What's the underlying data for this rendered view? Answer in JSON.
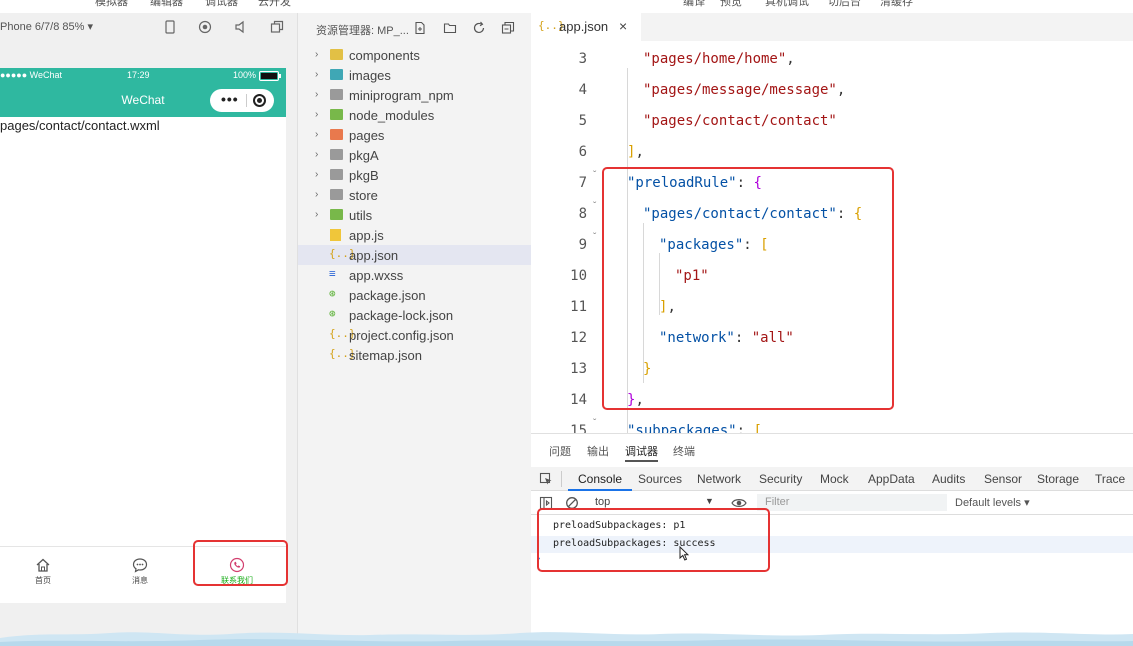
{
  "top_menu": [
    "模拟器",
    "编辑器",
    "调试器",
    "云开发",
    "编译",
    "预览",
    "真机调试",
    "切后台",
    "清缓存"
  ],
  "simulator": {
    "model": "Phone 6/7/8 85%",
    "dropdown_glyph": "▾",
    "status": {
      "carrier": "●●●●● WeChat",
      "time": "17:29",
      "battery": "100%"
    },
    "nav_title": "WeChat",
    "capsule_dots": "•••",
    "page_path": "pages/contact/contact.wxml",
    "tabs": [
      {
        "label": "首页",
        "icon": "home-icon"
      },
      {
        "label": "消息",
        "icon": "message-icon"
      },
      {
        "label": "联系我们",
        "icon": "phone-icon"
      }
    ]
  },
  "explorer": {
    "title": "资源管理器: MP_...",
    "items": [
      {
        "name": "components",
        "kind": "folder",
        "color": "#e2c045"
      },
      {
        "name": "images",
        "kind": "folder",
        "color": "#3fa7b5"
      },
      {
        "name": "miniprogram_npm",
        "kind": "folder",
        "color": "#9a9a9a"
      },
      {
        "name": "node_modules",
        "kind": "folder",
        "color": "#78b84a"
      },
      {
        "name": "pages",
        "kind": "folder",
        "color": "#e9794d"
      },
      {
        "name": "pkgA",
        "kind": "folder",
        "color": "#9a9a9a"
      },
      {
        "name": "pkgB",
        "kind": "folder",
        "color": "#9a9a9a"
      },
      {
        "name": "store",
        "kind": "folder",
        "color": "#9a9a9a"
      },
      {
        "name": "utils",
        "kind": "folder",
        "color": "#78b84a"
      },
      {
        "name": "app.js",
        "kind": "js"
      },
      {
        "name": "app.json",
        "kind": "json",
        "selected": true
      },
      {
        "name": "app.wxss",
        "kind": "wxss"
      },
      {
        "name": "package.json",
        "kind": "npm"
      },
      {
        "name": "package-lock.json",
        "kind": "npm"
      },
      {
        "name": "project.config.json",
        "kind": "json"
      },
      {
        "name": "sitemap.json",
        "kind": "json"
      }
    ],
    "glyphs": {
      "chevron": "›",
      "json": "{..}",
      "wxss": "≡",
      "npm": "⊛"
    }
  },
  "editor": {
    "tab": {
      "icon": "{..}",
      "name": "app.json",
      "close": "×"
    },
    "lines": [
      {
        "n": "3",
        "tokens": [
          [
            "s",
            "\"pages/home/home\""
          ],
          [
            "p",
            ","
          ]
        ],
        "indent": 2
      },
      {
        "n": "4",
        "tokens": [
          [
            "s",
            "\"pages/message/message\""
          ],
          [
            "p",
            ","
          ]
        ],
        "indent": 2
      },
      {
        "n": "5",
        "tokens": [
          [
            "s",
            "\"pages/contact/contact\""
          ]
        ],
        "indent": 2
      },
      {
        "n": "6",
        "tokens": [
          [
            "b2",
            "]"
          ],
          [
            "p",
            ","
          ]
        ],
        "indent": 1
      },
      {
        "n": "7",
        "tokens": [
          [
            "k",
            "\"preloadRule\""
          ],
          [
            "p",
            ": "
          ],
          [
            "b1",
            "{"
          ]
        ],
        "indent": 1,
        "fold": true
      },
      {
        "n": "8",
        "tokens": [
          [
            "k",
            "\"pages/contact/contact\""
          ],
          [
            "p",
            ": "
          ],
          [
            "b2",
            "{"
          ]
        ],
        "indent": 2,
        "fold": true
      },
      {
        "n": "9",
        "tokens": [
          [
            "k",
            "\"packages\""
          ],
          [
            "p",
            ": "
          ],
          [
            "b2",
            "["
          ]
        ],
        "indent": 3,
        "fold": true
      },
      {
        "n": "10",
        "tokens": [
          [
            "s",
            "\"p1\""
          ]
        ],
        "indent": 4
      },
      {
        "n": "11",
        "tokens": [
          [
            "b2",
            "]"
          ],
          [
            "p",
            ","
          ]
        ],
        "indent": 3
      },
      {
        "n": "12",
        "tokens": [
          [
            "k",
            "\"network\""
          ],
          [
            "p",
            ": "
          ],
          [
            "s",
            "\"all\""
          ]
        ],
        "indent": 3
      },
      {
        "n": "13",
        "tokens": [
          [
            "b2",
            "}"
          ]
        ],
        "indent": 2
      },
      {
        "n": "14",
        "tokens": [
          [
            "b1",
            "}"
          ],
          [
            "p",
            ","
          ]
        ],
        "indent": 1
      },
      {
        "n": "15",
        "tokens": [
          [
            "k",
            "\"subpackages\""
          ],
          [
            "p",
            ": "
          ],
          [
            "b2",
            "["
          ]
        ],
        "indent": 1,
        "fold": true
      }
    ]
  },
  "panel": {
    "tabs": [
      "问题",
      "输出",
      "调试器",
      "终端"
    ],
    "active_tab": "调试器",
    "devtools_tabs": [
      "Console",
      "Sources",
      "Network",
      "Security",
      "Mock",
      "AppData",
      "Audits",
      "Sensor",
      "Storage",
      "Trace"
    ],
    "active_devtools_tab": "Console",
    "context": "top",
    "context_arrow": "▼",
    "filter_placeholder": "Filter",
    "levels": "Default levels ▾",
    "console_lines": [
      "preloadSubpackages: p1",
      "preloadSubpackages: success"
    ],
    "prompt": "›"
  },
  "colors": {
    "accent": "#2fb8a0",
    "highlight": "#e53333",
    "active_tab": "#1aad19"
  }
}
